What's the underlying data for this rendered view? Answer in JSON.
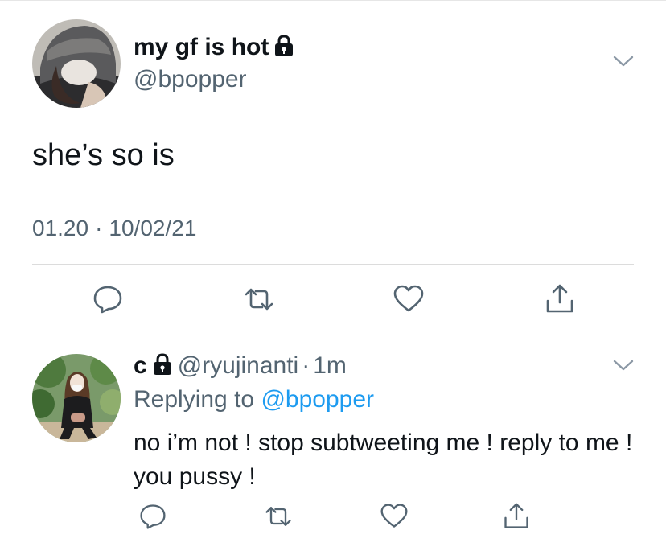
{
  "tweet": {
    "display_name": "my gf is hot",
    "handle": "@bpopper",
    "text": "she’s so is",
    "time": "01.20",
    "separator": "·",
    "date": "10/02/21",
    "protected": true
  },
  "reply": {
    "display_name": "c",
    "handle": "@ryujinanti",
    "separator": "·",
    "age": "1m",
    "replying_prefix": "Replying to",
    "replying_to": "@bpopper",
    "text": "no i’m not ! stop subtweeting me ! reply to me ! you pussy !",
    "protected": true
  },
  "actions": [
    "reply-icon",
    "retweet-icon",
    "like-icon",
    "share-icon"
  ],
  "colors": {
    "text": "#0f1419",
    "secondary": "#536471",
    "link": "#1d9bf0",
    "divider": "#dcdcdc"
  }
}
